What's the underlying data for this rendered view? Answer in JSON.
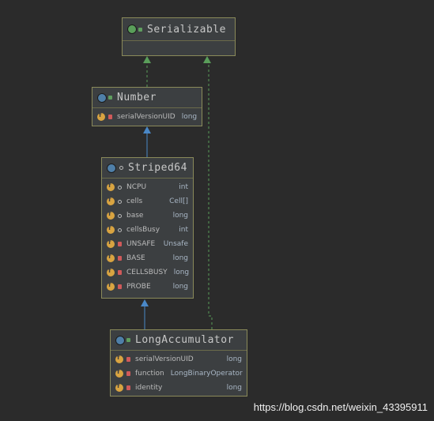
{
  "nodes": {
    "serializable": {
      "title": "Serializable",
      "fields": []
    },
    "number": {
      "title": "Number",
      "fields": [
        {
          "name": "serialVersionUID",
          "type": "long",
          "modifier": "private"
        }
      ]
    },
    "striped64": {
      "title": "Striped64",
      "fields": [
        {
          "name": "NCPU",
          "type": "int",
          "modifier": "package"
        },
        {
          "name": "cells",
          "type": "Cell[]",
          "modifier": "package"
        },
        {
          "name": "base",
          "type": "long",
          "modifier": "package"
        },
        {
          "name": "cellsBusy",
          "type": "int",
          "modifier": "package"
        },
        {
          "name": "UNSAFE",
          "type": "Unsafe",
          "modifier": "private"
        },
        {
          "name": "BASE",
          "type": "long",
          "modifier": "private"
        },
        {
          "name": "CELLSBUSY",
          "type": "long",
          "modifier": "private"
        },
        {
          "name": "PROBE",
          "type": "long",
          "modifier": "private"
        }
      ]
    },
    "longaccumulator": {
      "title": "LongAccumulator",
      "fields": [
        {
          "name": "serialVersionUID",
          "type": "long",
          "modifier": "private"
        },
        {
          "name": "function",
          "type": "LongBinaryOperator",
          "modifier": "private"
        },
        {
          "name": "identity",
          "type": "long",
          "modifier": "private"
        }
      ]
    }
  },
  "watermark": "https://blog.csdn.net/weixin_43395911",
  "colors": {
    "interface_badge": "#5a9e5a",
    "class_badge": "#4f7fa8",
    "abstract_badge": "#4f7fa8",
    "field_icon": "#d9a441",
    "extends_arrow": "#4a88c7",
    "implements_arrow": "#5a9e5a"
  }
}
